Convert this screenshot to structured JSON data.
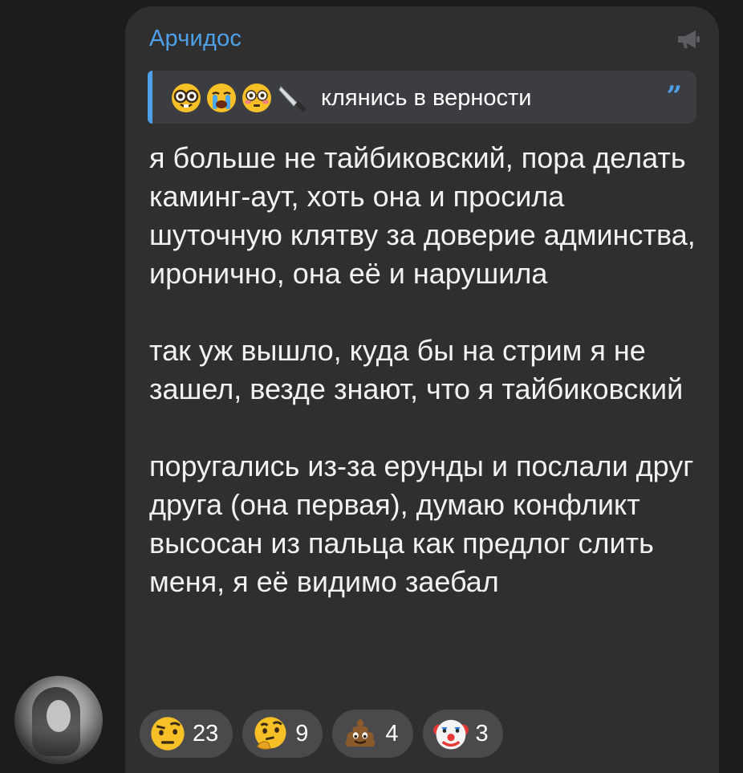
{
  "message": {
    "sender": "Арчидос",
    "channel_icon": "megaphone-icon",
    "reply": {
      "emojis": [
        "nerd-face-emoji",
        "crying-face-emoji",
        "flushed-face-emoji",
        "knife-emoji"
      ],
      "text": "клянись в верности"
    },
    "paragraphs": [
      "я больше не тайбиковский, пора делать каминг-аут, хоть она и просила шуточную клятву за доверие админства, иронично, она её и нарушила",
      "так уж вышло, куда бы на стрим я не зашел, везде знают, что я тайбиковский",
      "поругались из-за ерунды и послали друг друга (она первая), думаю конфликт высосан из пальца как предлог слить меня, я её видимо заебал"
    ]
  },
  "reactions": [
    {
      "emoji": "raised-eyebrow-emoji",
      "count": "23"
    },
    {
      "emoji": "thinking-face-emoji",
      "count": "9"
    },
    {
      "emoji": "pile-of-poo-emoji",
      "count": "4"
    },
    {
      "emoji": "clown-face-emoji",
      "count": "3"
    }
  ],
  "colors": {
    "background": "#1c1c1e",
    "bubble": "#2f2f30",
    "accent": "#4ea1e8",
    "reaction_bg": "#4a4a4c"
  }
}
